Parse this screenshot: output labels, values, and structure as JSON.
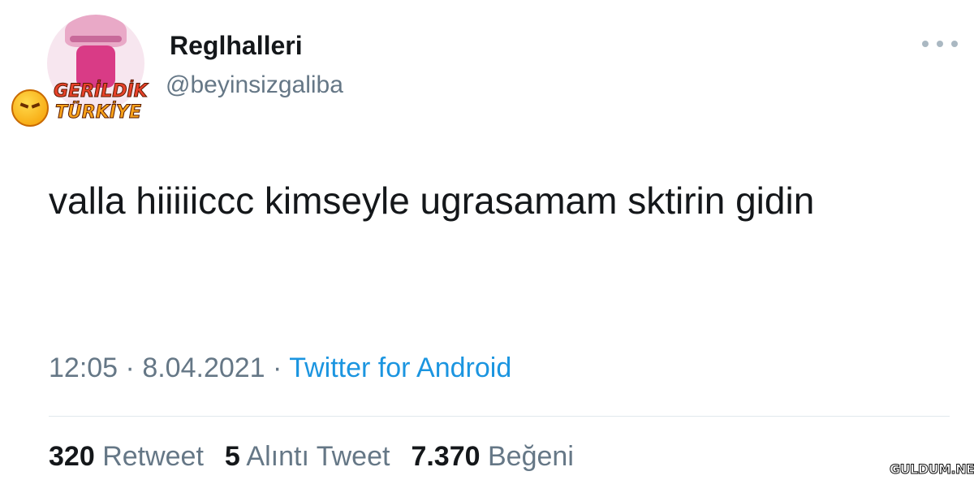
{
  "user": {
    "display_name": "Reglhalleri",
    "handle": "@beyinsizgaliba",
    "badge_line1": "GERİLDİK",
    "badge_line2": "TÜRKİYE"
  },
  "tweet": {
    "text": "valla hiiiiiccc kimseyle ugrasamam sktirin gidin",
    "time": "12:05",
    "separator": "·",
    "date": "8.04.2021",
    "source": "Twitter for Android"
  },
  "stats": {
    "retweets_count": "320",
    "retweets_label": "Retweet",
    "quotes_count": "5",
    "quotes_label": "Alıntı Tweet",
    "likes_count": "7.370",
    "likes_label": "Beğeni"
  },
  "watermark": "GULDUM.NET",
  "icons": {
    "more": "more-options-icon"
  },
  "colors": {
    "text_primary": "#14171a",
    "text_secondary": "#657786",
    "link": "#1b95e0",
    "divider": "#e1e8ed"
  }
}
